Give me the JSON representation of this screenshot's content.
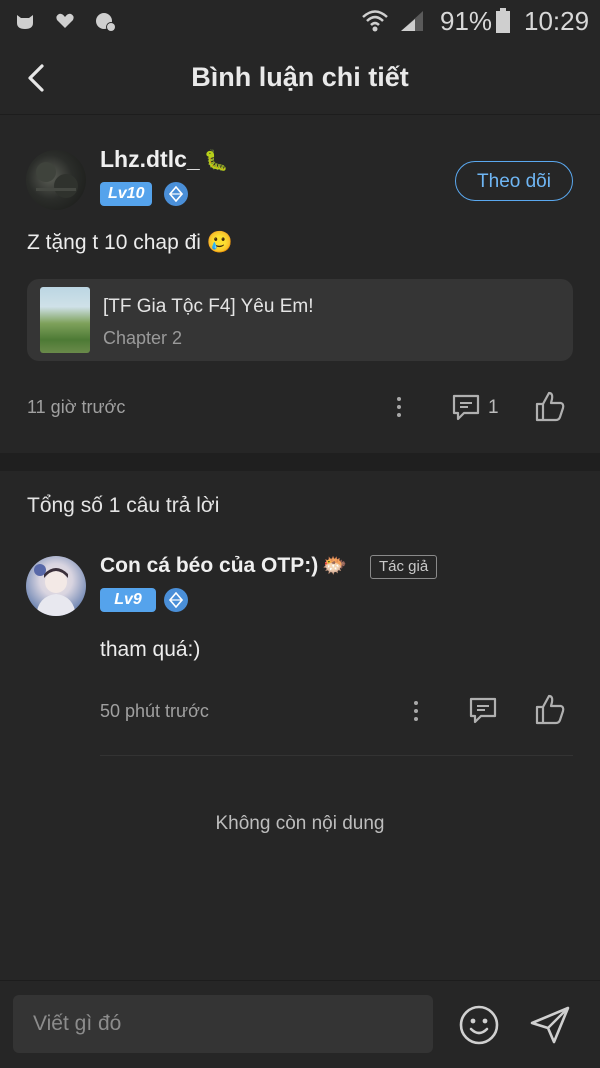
{
  "status_bar": {
    "battery": "91%",
    "time": "10:29"
  },
  "header": {
    "title": "Bình luận chi tiết"
  },
  "post": {
    "username": "Lhz.dtlc_",
    "username_emoji": "🐛",
    "level": "Lv10",
    "follow_label": "Theo dõi",
    "content": "Z tặng t 10 chap đi 🥲",
    "card": {
      "title": "[TF Gia Tộc F4] Yêu Em!",
      "subtitle": "Chapter 2"
    },
    "time": "11 giờ trước",
    "comment_count": "1"
  },
  "replies": {
    "total_label": "Tổng số 1 câu trả lời",
    "items": [
      {
        "username": "Con cá béo của OTP:)",
        "username_emoji": "🐡",
        "author_tag": "Tác giả",
        "level": "Lv9",
        "content": "tham quá:)",
        "time": "50 phút trước"
      }
    ],
    "end_label": "Không còn nội dung"
  },
  "composer": {
    "placeholder": "Viết gì đó"
  },
  "colors": {
    "background": "#262626",
    "accent": "#55a3ec",
    "follow_border": "#5aa8ef"
  },
  "icons": [
    "cat-icon",
    "heart-365-icon",
    "paw-notification-icon",
    "wifi-icon",
    "signal-icon",
    "battery-icon",
    "back-arrow-icon",
    "diamond-icon",
    "more-icon",
    "comment-icon",
    "like-icon",
    "smiley-icon",
    "send-icon"
  ]
}
